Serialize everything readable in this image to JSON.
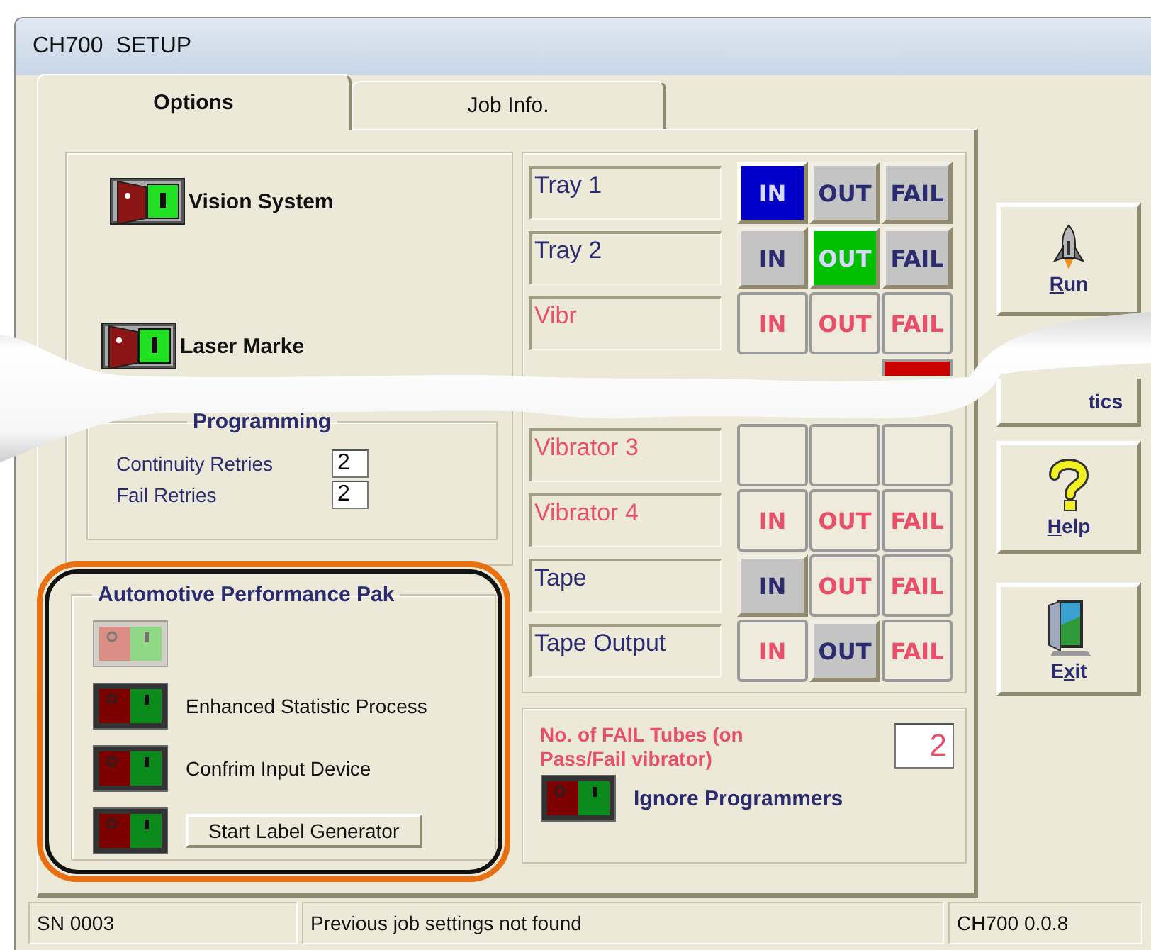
{
  "window": {
    "title": "CH700  SETUP"
  },
  "tabs": [
    {
      "label": "Options",
      "selected": true
    },
    {
      "label": "Job Info.",
      "selected": false
    }
  ],
  "options": {
    "devices": [
      {
        "label": "Vision System"
      },
      {
        "label": "Laser Marke"
      }
    ],
    "programming": {
      "title": "Programming",
      "fields": [
        {
          "label": "Continuity Retries",
          "value": "2"
        },
        {
          "label": "Fail Retries",
          "value": "2"
        }
      ]
    },
    "performance_pak": {
      "title": "Automotive Performance Pak",
      "switches": [
        {
          "kind": "plain",
          "disabled": true
        },
        {
          "kind": "text",
          "label": "Enhanced Statistic Process",
          "disabled": false
        },
        {
          "kind": "text",
          "label": "Confrim Input Device",
          "disabled": false
        },
        {
          "kind": "button",
          "label": "Start Label Generator",
          "disabled": false
        }
      ]
    }
  },
  "routing": [
    {
      "label": "Tray 1",
      "active": true,
      "buttons": [
        {
          "label": "IN",
          "kind": "lit",
          "color": "#0000c8"
        },
        {
          "label": "OUT",
          "kind": "raised"
        },
        {
          "label": "FAIL",
          "kind": "raised"
        }
      ]
    },
    {
      "label": "Tray 2",
      "active": true,
      "buttons": [
        {
          "label": "IN",
          "kind": "raised"
        },
        {
          "label": "OUT",
          "kind": "lit",
          "color": "#00c000"
        },
        {
          "label": "FAIL",
          "kind": "raised"
        }
      ]
    },
    {
      "label": "Vibr",
      "active": false,
      "buttons": [
        {
          "label": "IN",
          "kind": "flat"
        },
        {
          "label": "OUT",
          "kind": "flat"
        },
        {
          "label": "FAIL",
          "kind": "flat"
        }
      ]
    },
    {
      "kind": "cut",
      "buttons": [
        {
          "kind": "lit",
          "color": "#c80000"
        }
      ]
    },
    {
      "label": "Vibrator 3",
      "active": false,
      "buttons": [
        {
          "kind": "flat"
        },
        {
          "kind": "flat"
        },
        {
          "kind": "flat"
        }
      ]
    },
    {
      "label": "Vibrator 4",
      "active": false,
      "buttons": [
        {
          "label": "IN",
          "kind": "flat"
        },
        {
          "label": "OUT",
          "kind": "flat"
        },
        {
          "label": "FAIL",
          "kind": "flat"
        }
      ]
    },
    {
      "label": "Tape",
      "active": true,
      "buttons": [
        {
          "label": "IN",
          "kind": "raised"
        },
        {
          "label": "OUT",
          "kind": "flat"
        },
        {
          "label": "FAIL",
          "kind": "flat"
        }
      ]
    },
    {
      "label": "Tape Output",
      "active": true,
      "buttons": [
        {
          "label": "IN",
          "kind": "flat"
        },
        {
          "label": "OUT",
          "kind": "raised"
        },
        {
          "label": "FAIL",
          "kind": "flat"
        }
      ]
    }
  ],
  "fail_tubes": {
    "label": "No. of FAIL Tubes  (on Pass/Fail vibrator)",
    "value": "2",
    "switch_label": "Ignore Programmers"
  },
  "side_buttons": [
    {
      "kind": "run",
      "accel": "R",
      "after": "un"
    },
    {
      "kind": "stats",
      "after": "tics"
    },
    {
      "kind": "help",
      "accel": "H",
      "after": "elp"
    },
    {
      "kind": "exit",
      "before": "E",
      "accel": "x",
      "after": "it"
    }
  ],
  "status_bar": [
    "SN 0003",
    "Previous job settings not found",
    "CH700 0.0.8"
  ]
}
